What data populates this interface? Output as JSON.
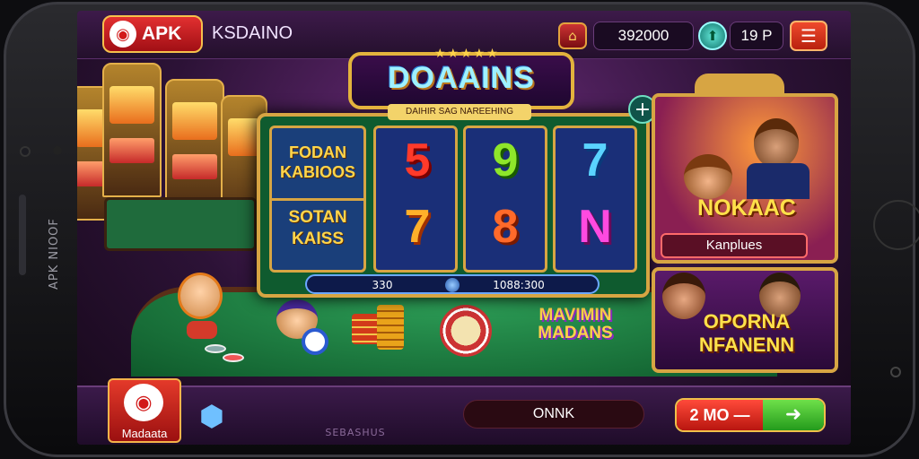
{
  "device": {
    "side_label": "APK NIOOF"
  },
  "topbar": {
    "apk_badge": "APK",
    "brand": "KSDAINO",
    "coins": "392000",
    "level": "19 P"
  },
  "slot": {
    "title": "DOAAINS",
    "subtitle": "DAIHIR SAG NAREEHING",
    "side_top": "FODAN KABIOOS",
    "side_bottom": "SOTAN KAISS",
    "reels": [
      [
        "5",
        "7"
      ],
      [
        "9",
        "8"
      ],
      [
        "7",
        "N"
      ]
    ],
    "pay_left": "330",
    "pay_right": "1088:300"
  },
  "promo1": {
    "title": "NOKAAC",
    "button": "Kanplues"
  },
  "promo2": {
    "title": "OPORNA NFANENN"
  },
  "mini_logo": "MAVIMIN MADANS",
  "bottombar": {
    "app_label": "Madaata",
    "center_label": "SEBASHUS",
    "pill": "ONNK",
    "bet": "2 MO —"
  },
  "icons": {
    "apk": "apk-logo-icon",
    "home": "home-icon",
    "gem": "gem-icon",
    "menu": "menu-icon",
    "plus": "plus-icon",
    "cube": "cube-icon",
    "arrow": "arrow-right-icon"
  },
  "colors": {
    "gold": "#d7a543",
    "accent_red": "#e23030",
    "accent_green": "#3cc02a",
    "felt_green": "#1f8a45"
  }
}
